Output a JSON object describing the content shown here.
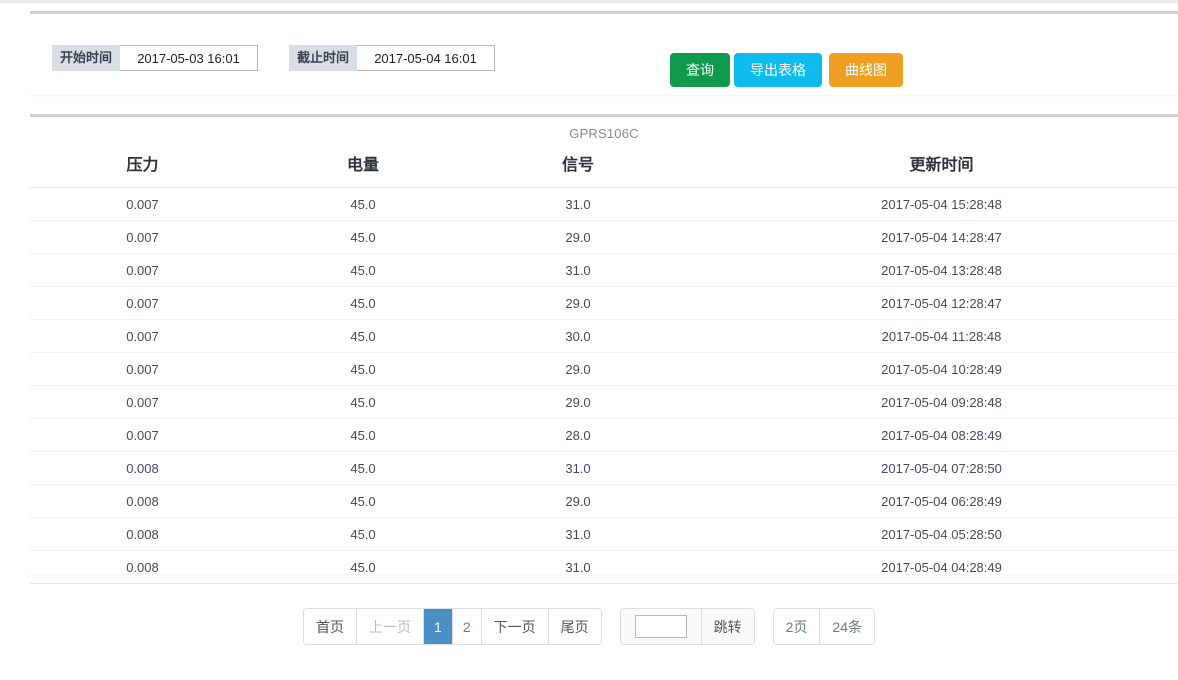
{
  "toolbar": {
    "start_label": "开始时间",
    "start_value": "2017-05-03 16:01",
    "start_placeholder": "开始时间",
    "end_label": "截止时间",
    "end_value": "2017-05-04 16:01",
    "end_placeholder": "截止时间",
    "query_label": "查询",
    "export_label": "导出表格",
    "chart_label": "曲线图",
    "colors": {
      "query": "#109a4d",
      "export": "#0dbbee",
      "chart": "#efa022",
      "label_bg": "#d9dde5"
    }
  },
  "table": {
    "title": "GPRS106C",
    "columns": [
      "压力",
      "电量",
      "信号",
      "更新时间"
    ],
    "rows": [
      [
        "0.007",
        "45.0",
        "31.0",
        "2017-05-04 15:28:48"
      ],
      [
        "0.007",
        "45.0",
        "29.0",
        "2017-05-04 14:28:47"
      ],
      [
        "0.007",
        "45.0",
        "31.0",
        "2017-05-04 13:28:48"
      ],
      [
        "0.007",
        "45.0",
        "29.0",
        "2017-05-04 12:28:47"
      ],
      [
        "0.007",
        "45.0",
        "30.0",
        "2017-05-04 11:28:48"
      ],
      [
        "0.007",
        "45.0",
        "29.0",
        "2017-05-04 10:28:49"
      ],
      [
        "0.007",
        "45.0",
        "29.0",
        "2017-05-04 09:28:48"
      ],
      [
        "0.007",
        "45.0",
        "28.0",
        "2017-05-04 08:28:49"
      ],
      [
        "0.008",
        "45.0",
        "31.0",
        "2017-05-04 07:28:50"
      ],
      [
        "0.008",
        "45.0",
        "29.0",
        "2017-05-04 06:28:49"
      ],
      [
        "0.008",
        "45.0",
        "31.0",
        "2017-05-04 05:28:50"
      ],
      [
        "0.008",
        "45.0",
        "31.0",
        "2017-05-04 04:28:49"
      ]
    ]
  },
  "pagination": {
    "first_label": "首页",
    "prev_label": "上一页",
    "page_1": "1",
    "page_2": "2",
    "next_label": "下一页",
    "last_label": "尾页",
    "jump_value": "",
    "jump_placeholder": "",
    "jump_label": "跳转",
    "total_pages": "2页",
    "total_records": "24条",
    "active_page": "1",
    "active_color": "#4a90c4"
  }
}
